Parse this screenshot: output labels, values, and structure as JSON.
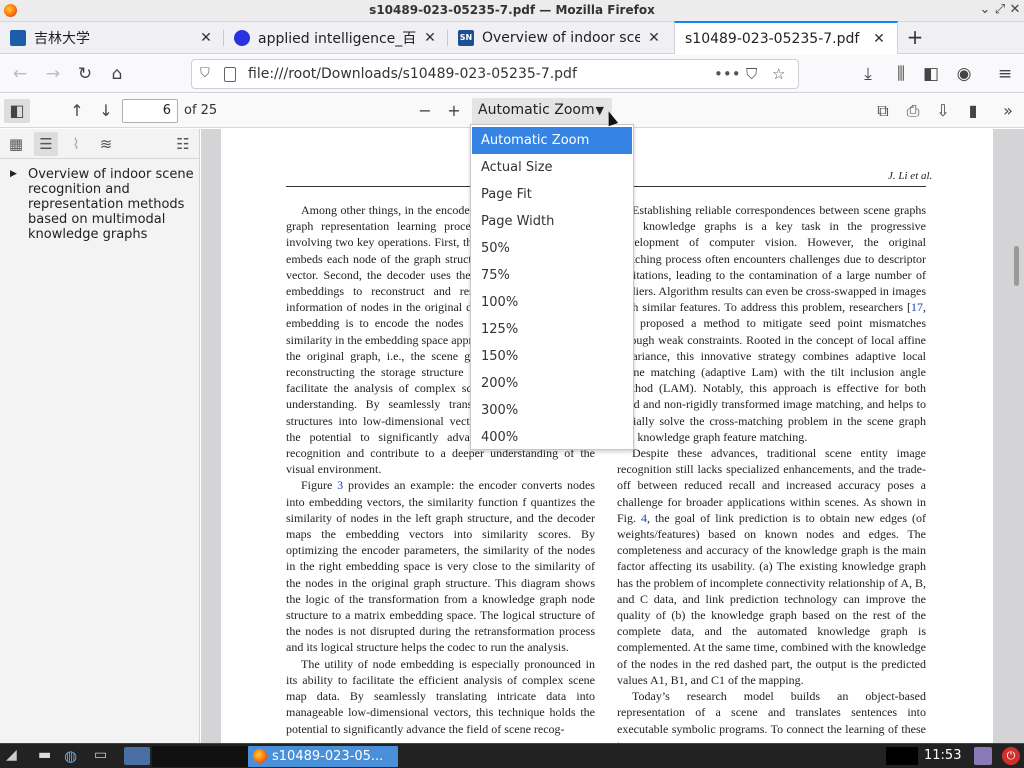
{
  "window": {
    "title": "s10489-023-05235-7.pdf — Mozilla Firefox"
  },
  "tabs": [
    {
      "label": "吉林大学",
      "favicon_color": "#1a5ea8"
    },
    {
      "label": "applied intelligence_百度",
      "favicon_color": "#2932e1"
    },
    {
      "label": "Overview of indoor scen",
      "favicon_color": "#1b4f8f"
    },
    {
      "label": "s10489-023-05235-7.pdf",
      "favicon_color": "#ffffff"
    }
  ],
  "navbar": {
    "url": "file:///root/Downloads/s10489-023-05235-7.pdf"
  },
  "pdf_toolbar": {
    "page_number": "6",
    "num_pages": "of 25",
    "zoom_selected": "Automatic Zoom"
  },
  "zoom_options": [
    "Automatic Zoom",
    "Actual Size",
    "Page Fit",
    "Page Width",
    "50%",
    "75%",
    "100%",
    "125%",
    "150%",
    "200%",
    "300%",
    "400%"
  ],
  "sidebar": {
    "outline_item": "Overview of indoor scene recognition and representation methods based on multimodal knowledge graphs"
  },
  "document": {
    "running_head": "J. Li et al.",
    "left_col_p1": "Among other things, in the encoder–decoder framework, the graph representation learning process follows an approach involving two key operations. First, the encoder model maps or embeds each node of the graph structure to a low-dimensional vector. Second, the decoder uses these low-dimensional node embeddings to reconstruct and restruct the neighborhood information of nodes in the original data. The purpose of node embedding is to encode the nodes of the graph so that the similarity in the embedding space approximates the similarity in the original graph, i.e., the scene graph entity nodes, while reconstructing the storage structure in parallel. Its role is to facilitate the analysis of complex scene graph data to scene understanding. By seamlessly transforming intricate graph structures into low-dimensional vectors, this technique holds the potential to significantly advance the field of scene recognition and contribute to a deeper understanding of the visual environment.",
    "left_col_p2_pre": "Figure ",
    "left_col_p2_link": "3",
    "left_col_p2_post": " provides an example: the encoder converts nodes into embedding vectors, the similarity function f quantizes the similarity of nodes in the left graph structure, and the decoder maps the embedding vectors into similarity scores. By optimizing the encoder parameters, the similarity of the nodes in the right embedding space is very close to the similarity of the nodes in the original graph structure. This diagram shows the logic of the transformation from a knowledge graph node structure to a matrix embedding space. The logical structure of the nodes is not disrupted during the retransformation process and its logical structure helps the codec to run the analysis.",
    "left_col_p3": "The utility of node embedding is especially pronounced in its ability to facilitate the efficient analysis of complex scene map data. By seamlessly translating intricate data into manageable low-dimensional vectors, this technique holds the potential to significantly advance the field of scene recog-",
    "right_col_p1_pre": "Establishing reliable correspondences between scene graphs and knowledge graphs is a key task in the progressive development of computer vision. However, the original matching process often encounters challenges due to descriptor limitations, leading to the contamination of a large number of outliers. Algorithm results can even be cross-swapped in images with similar features. To address this problem, researchers [",
    "right_col_p1_ref1": "17",
    "right_col_p1_mid": ", ",
    "right_col_p1_ref2": "18",
    "right_col_p1_post": "] proposed a method to mitigate seed point mismatches through weak constraints. Rooted in the concept of local affine invariance, this innovative strategy combines adaptive local affine matching (adaptive Lam) with the tilt inclusion angle method (LAM). Notably, this approach is effective for both rigid and non-rigidly transformed image matching, and helps to initially solve the cross-matching problem in the scene graph and knowledge graph feature matching.",
    "right_col_p2_pre": "Despite these advances, traditional scene entity image recognition still lacks specialized enhancements, and the trade-off between reduced recall and increased accuracy poses a challenge for broader applications within scenes. As shown in Fig. ",
    "right_col_p2_link": "4",
    "right_col_p2_post": ", the goal of link prediction is to obtain new edges (of weights/features) based on known nodes and edges. The completeness and accuracy of the knowledge graph is the main factor affecting its usability. (a) The existing knowledge graph has the problem of incomplete connectivity relationship of A, B, and C data, and link prediction technology can improve the quality of (b) the knowledge graph based on the rest of the complete data, and the automated knowledge graph is complemented. At the same time, combined with the knowledge of the nodes in the red dashed part, the output is the predicted values A1, B1, and C1 of the mapping.",
    "right_col_p3": "Today’s research model builds an object-based representation of a scene and translates sentences into executable symbolic programs. To connect the learning of these two"
  },
  "taskbar": {
    "window_label": "s10489-023-05...",
    "clock": "11:53"
  }
}
